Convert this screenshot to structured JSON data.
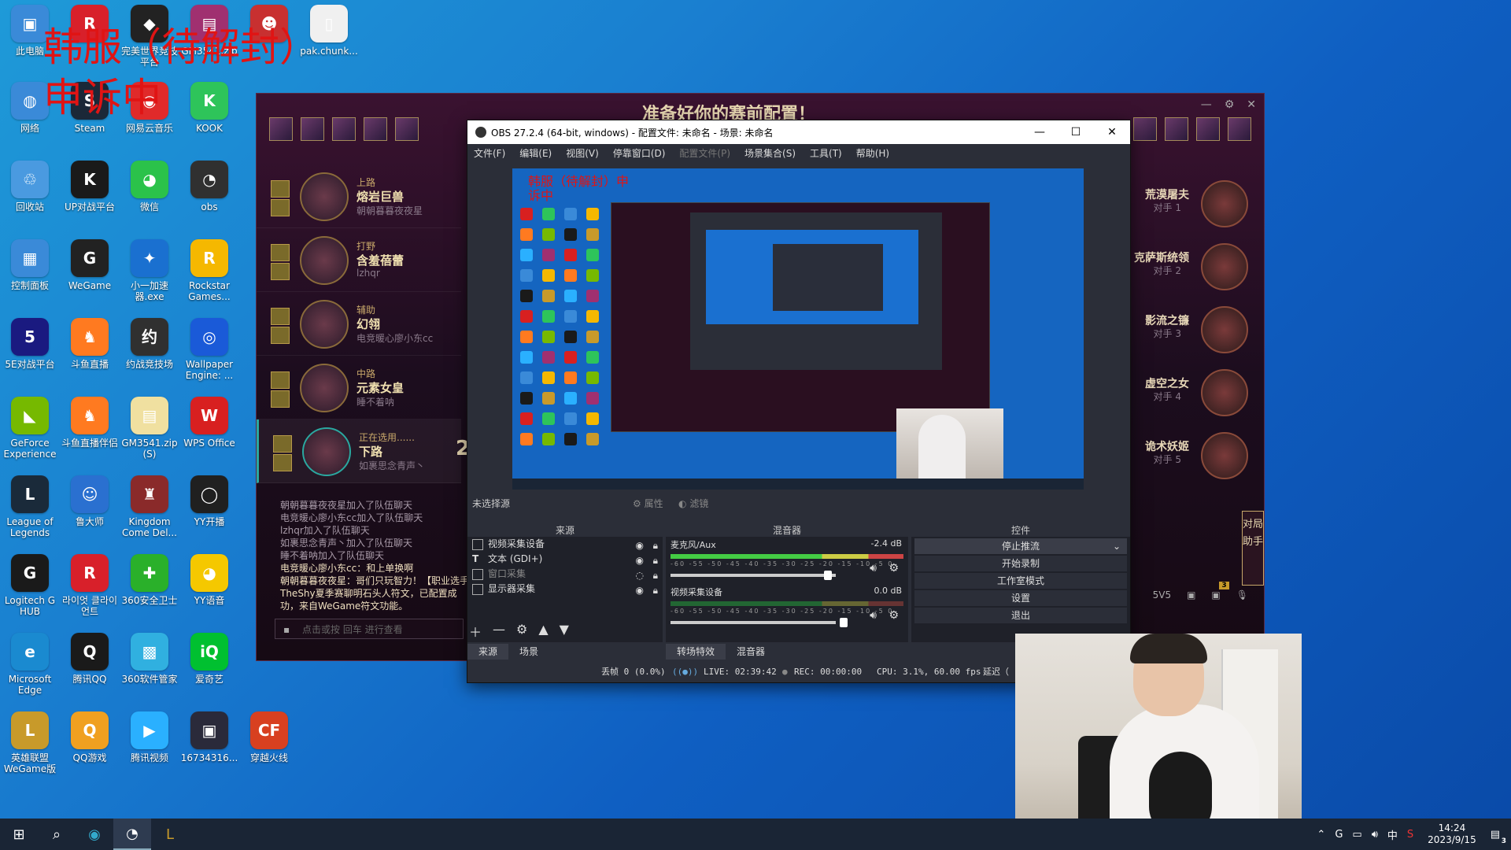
{
  "desktop": {
    "overlay_line1": "韩服（待解封）",
    "overlay_line2": "申诉中",
    "icons": [
      {
        "label": "此电脑",
        "color": "#3a8ad8",
        "glyph": "▣"
      },
      {
        "label": "",
        "color": "#d8202a",
        "glyph": "R"
      },
      {
        "label": "完美世界竞技平台",
        "color": "#222222",
        "glyph": "◆"
      },
      {
        "label": "GM3541.zip",
        "color": "#a03070",
        "glyph": "▤"
      },
      {
        "label": "",
        "color": "#c83030",
        "glyph": "☻"
      },
      {
        "label": "pak.chunk...",
        "color": "#f0f0f0",
        "glyph": "▯"
      },
      {
        "label": "网络",
        "color": "#3a8ad8",
        "glyph": "◍"
      },
      {
        "label": "Steam",
        "color": "#1b2838",
        "glyph": "S"
      },
      {
        "label": "网易云音乐",
        "color": "#e02a2a",
        "glyph": "◉"
      },
      {
        "label": "KOOK",
        "color": "#2ec45a",
        "glyph": "K"
      },
      {
        "label": "回收站",
        "color": "#4a9ae0",
        "glyph": "♲"
      },
      {
        "label": "UP对战平台",
        "color": "#1a1a1a",
        "glyph": "K"
      },
      {
        "label": "微信",
        "color": "#2bc24a",
        "glyph": "◕"
      },
      {
        "label": "obs",
        "color": "#303030",
        "glyph": "◔"
      },
      {
        "label": "控制面板",
        "color": "#3a8ad8",
        "glyph": "▦"
      },
      {
        "label": "WeGame",
        "color": "#222222",
        "glyph": "G"
      },
      {
        "label": "小一加速器.exe",
        "color": "#1a70d0",
        "glyph": "✦"
      },
      {
        "label": "Rockstar Games...",
        "color": "#f5b800",
        "glyph": "R"
      },
      {
        "label": "5E对战平台",
        "color": "#1a1a80",
        "glyph": "5"
      },
      {
        "label": "斗鱼直播",
        "color": "#ff7a20",
        "glyph": "♞"
      },
      {
        "label": "约战竞技场",
        "color": "#303030",
        "glyph": "约"
      },
      {
        "label": "Wallpaper Engine: ...",
        "color": "#1a5ad8",
        "glyph": "◎"
      },
      {
        "label": "GeForce Experience",
        "color": "#76b900",
        "glyph": "◣"
      },
      {
        "label": "斗鱼直播伴侣",
        "color": "#ff7a20",
        "glyph": "♞"
      },
      {
        "label": "GM3541.zip (S)",
        "color": "#f0e0a0",
        "glyph": "▤"
      },
      {
        "label": "WPS Office",
        "color": "#d82020",
        "glyph": "W"
      },
      {
        "label": "League of Legends",
        "color": "#1a2a3a",
        "glyph": "L"
      },
      {
        "label": "鲁大师",
        "color": "#2a70d0",
        "glyph": "☺"
      },
      {
        "label": "Kingdom Come Del...",
        "color": "#8a2a2a",
        "glyph": "♜"
      },
      {
        "label": "YY开播",
        "color": "#202020",
        "glyph": "◯"
      },
      {
        "label": "Logitech G HUB",
        "color": "#1a1a1a",
        "glyph": "G"
      },
      {
        "label": "라이엇 클라이언트",
        "color": "#d8202a",
        "glyph": "R"
      },
      {
        "label": "360安全卫士",
        "color": "#2ab02a",
        "glyph": "✚"
      },
      {
        "label": "YY语音",
        "color": "#f5c800",
        "glyph": "◕"
      },
      {
        "label": "Microsoft Edge",
        "color": "#1a8ad0",
        "glyph": "e"
      },
      {
        "label": "腾讯QQ",
        "color": "#1a1a1a",
        "glyph": "Q"
      },
      {
        "label": "360软件管家",
        "color": "#30b0e0",
        "glyph": "▩"
      },
      {
        "label": "爱奇艺",
        "color": "#00c030",
        "glyph": "iQ"
      },
      {
        "label": "英雄联盟WeGame版",
        "color": "#c89a2a",
        "glyph": "L"
      },
      {
        "label": "QQ游戏",
        "color": "#f0a020",
        "glyph": "Q"
      },
      {
        "label": "腾讯视频",
        "color": "#2ab0ff",
        "glyph": "▶"
      },
      {
        "label": "16734316...",
        "color": "#2a2a3a",
        "glyph": "▣"
      },
      {
        "label": "穿越火线",
        "color": "#d84020",
        "glyph": "CF"
      }
    ]
  },
  "lol": {
    "title": "准备好你的赛前配置！",
    "picks": [
      {
        "role": "上路",
        "champion": "熔岩巨兽",
        "player": "朝朝暮暮夜夜星"
      },
      {
        "role": "打野",
        "champion": "含羞蓓蕾",
        "player": "lzhqr"
      },
      {
        "role": "辅助",
        "champion": "幻翎",
        "player": "电竞暖心廖小东cc"
      },
      {
        "role": "中路",
        "champion": "元素女皇",
        "player": "睡不着呐"
      },
      {
        "role": "正在选用......",
        "champion": "下路",
        "player": "如裹思念青声丶"
      }
    ],
    "timer": "2",
    "chat": [
      "朝朝暮暮夜夜星加入了队伍聊天",
      "电竞暖心廖小东cc加入了队伍聊天",
      "lzhqr加入了队伍聊天",
      "如裹思念青声丶加入了队伍聊天",
      "睡不着呐加入了队伍聊天",
      "电竞暖心廖小东cc：和上单换啊",
      "朝朝暮暮夜夜星：哥们只玩智力！【职业选手TheShy夏季赛聊明石头人符文，已配置成功，来自WeGame符文功能。"
    ],
    "chat_placeholder": "点击或按 回车 进行查看",
    "enemies": [
      {
        "name": "荒漠屠夫",
        "sub": "对手 1"
      },
      {
        "name": "克萨斯统领",
        "sub": "对手 2"
      },
      {
        "name": "影流之镰",
        "sub": "对手 3"
      },
      {
        "name": "虚空之女",
        "sub": "对手 4"
      },
      {
        "name": "诡术妖姬",
        "sub": "对手 5"
      }
    ],
    "assist_label": "对局助手",
    "mode_label": "5V5",
    "badge": "3"
  },
  "obs": {
    "title": "OBS 27.2.4 (64-bit, windows) - 配置文件: 未命名 - 场景: 未命名",
    "menu": [
      "文件(F)",
      "编辑(E)",
      "视图(V)",
      "停靠窗口(D)",
      "配置文件(P)",
      "场景集合(S)",
      "工具(T)",
      "帮助(H)"
    ],
    "preview_overlay": "韩服（待解封）申诉中",
    "no_source": "未选择源",
    "props_btn": "属性",
    "filters_btn": "滤镜",
    "sources_header": "来源",
    "sources": [
      {
        "name": "视频采集设备",
        "dim": false
      },
      {
        "name": "文本 (GDI+)",
        "dim": false
      },
      {
        "name": "窗口采集",
        "dim": true
      },
      {
        "name": "显示器采集",
        "dim": false
      }
    ],
    "mixer_header": "混音器",
    "mixer": [
      {
        "name": "麦克风/Aux",
        "db": "-2.4 dB"
      },
      {
        "name": "视频采集设备",
        "db": "0.0 dB"
      }
    ],
    "mixer_scale": "-60 -55 -50 -45 -40 -35 -30 -25 -20 -15 -10 -5 0",
    "controls_header": "控件",
    "controls": [
      "停止推流",
      "开始录制",
      "工作室模式",
      "设置",
      "退出"
    ],
    "tabs_left": [
      "来源",
      "场景"
    ],
    "tabs_mid": [
      "转场特效",
      "混音器"
    ],
    "status": {
      "dropped": "丢帧 0 (0.0%)",
      "live": "LIVE: 02:39:42",
      "rec": "REC: 00:00:00",
      "cpu": "CPU: 3.1%, 60.00 fps",
      "delay": "延迟（"
    }
  },
  "taskbar": {
    "time": "14:24",
    "date": "2023/9/15",
    "ime": "中",
    "notification_count": "3"
  }
}
